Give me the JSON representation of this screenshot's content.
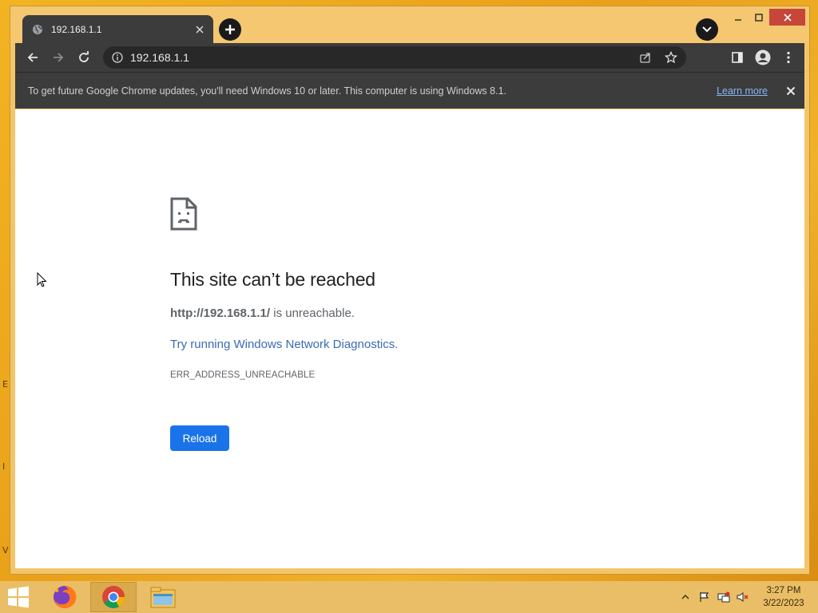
{
  "browser": {
    "tab_title": "192.168.1.1",
    "url": "192.168.1.1"
  },
  "infobar": {
    "message": "To get future Google Chrome updates, you'll need Windows 10 or later. This computer is using Windows 8.1.",
    "link": "Learn more"
  },
  "error_page": {
    "title": "This site can’t be reached",
    "url_bold": "http://192.168.1.1/",
    "unreachable_text": " is unreachable.",
    "suggestion_link": "Try running Windows Network Diagnostics",
    "suggestion_end": ".",
    "error_code": "ERR_ADDRESS_UNREACHABLE",
    "reload_label": "Reload"
  },
  "desktop_edge": {
    "letter_1": "E",
    "letter_2": "I",
    "letter_3": "V"
  },
  "taskbar": {
    "apps": [
      "firefox-icon",
      "chrome-icon",
      "file-explorer-icon"
    ],
    "clock_time": "3:27 PM",
    "clock_date": "3/22/2023"
  },
  "colors": {
    "accent_blue": "#1a73e8",
    "link_blue": "#3a6bb5",
    "close_red": "#c7463a",
    "wallpaper": "#e9a01a"
  }
}
